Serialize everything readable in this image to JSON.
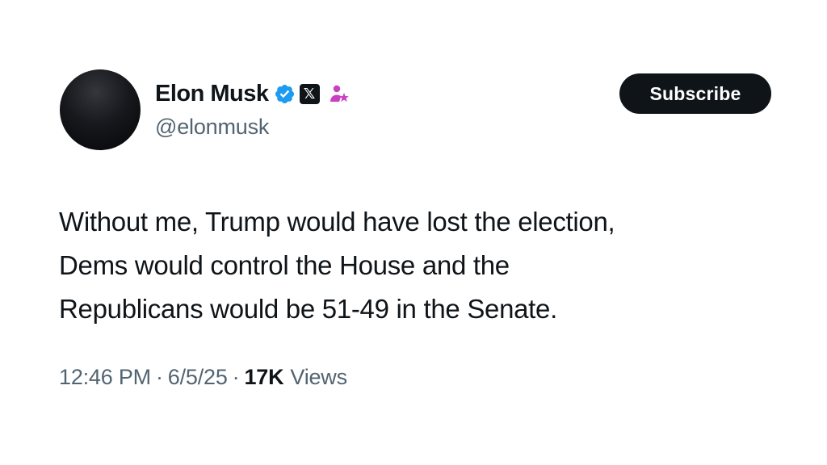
{
  "author": {
    "display_name": "Elon Musk",
    "handle": "@elonmusk",
    "badges": [
      "verified-icon",
      "x-affiliation-icon",
      "government-icon"
    ],
    "x_badge_glyph": "𝕏"
  },
  "actions": {
    "subscribe_label": "Subscribe"
  },
  "tweet": {
    "lines": [
      "Without me, Trump would have lost the election,",
      "Dems would control the House and the",
      "Republicans would be 51-49 in the Senate."
    ]
  },
  "meta": {
    "time": "12:46 PM",
    "separator": "·",
    "date": "6/5/25",
    "views_count": "17K",
    "views_label": "Views"
  },
  "colors": {
    "text_primary": "#0f1419",
    "text_secondary": "#536471",
    "verified_blue": "#1d9bf0",
    "gov_badge_magenta": "#c940c0",
    "button_bg": "#0f1419"
  }
}
